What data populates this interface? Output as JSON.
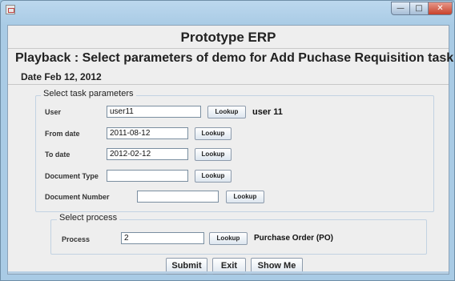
{
  "window": {
    "app_icon": "java-cup-icon",
    "buttons": {
      "minimize": "—",
      "maximize": "□",
      "close": "✕"
    }
  },
  "header": {
    "title": "Prototype ERP",
    "subtitle": "Playback : Select parameters of demo for Add Puchase Requisition task",
    "date": "Date Feb 12, 2012"
  },
  "task_params": {
    "legend": "Select task parameters",
    "user": {
      "label": "User",
      "value": "user11",
      "button": "Lookup",
      "result": "user 11"
    },
    "from_date": {
      "label": "From date",
      "value": "2011-08-12",
      "button": "Lookup"
    },
    "to_date": {
      "label": "To date",
      "value": "2012-02-12",
      "button": "Lookup"
    },
    "document_type": {
      "label": "Document Type",
      "value": "",
      "button": "Lookup"
    },
    "document_number": {
      "label": "Document Number",
      "value": "",
      "button": "Lookup"
    }
  },
  "process": {
    "legend": "Select process",
    "label": "Process",
    "value": "2",
    "button": "Lookup",
    "result": "Purchase Order (PO)"
  },
  "actions": {
    "submit": "Submit",
    "exit": "Exit",
    "show_me": "Show Me"
  }
}
